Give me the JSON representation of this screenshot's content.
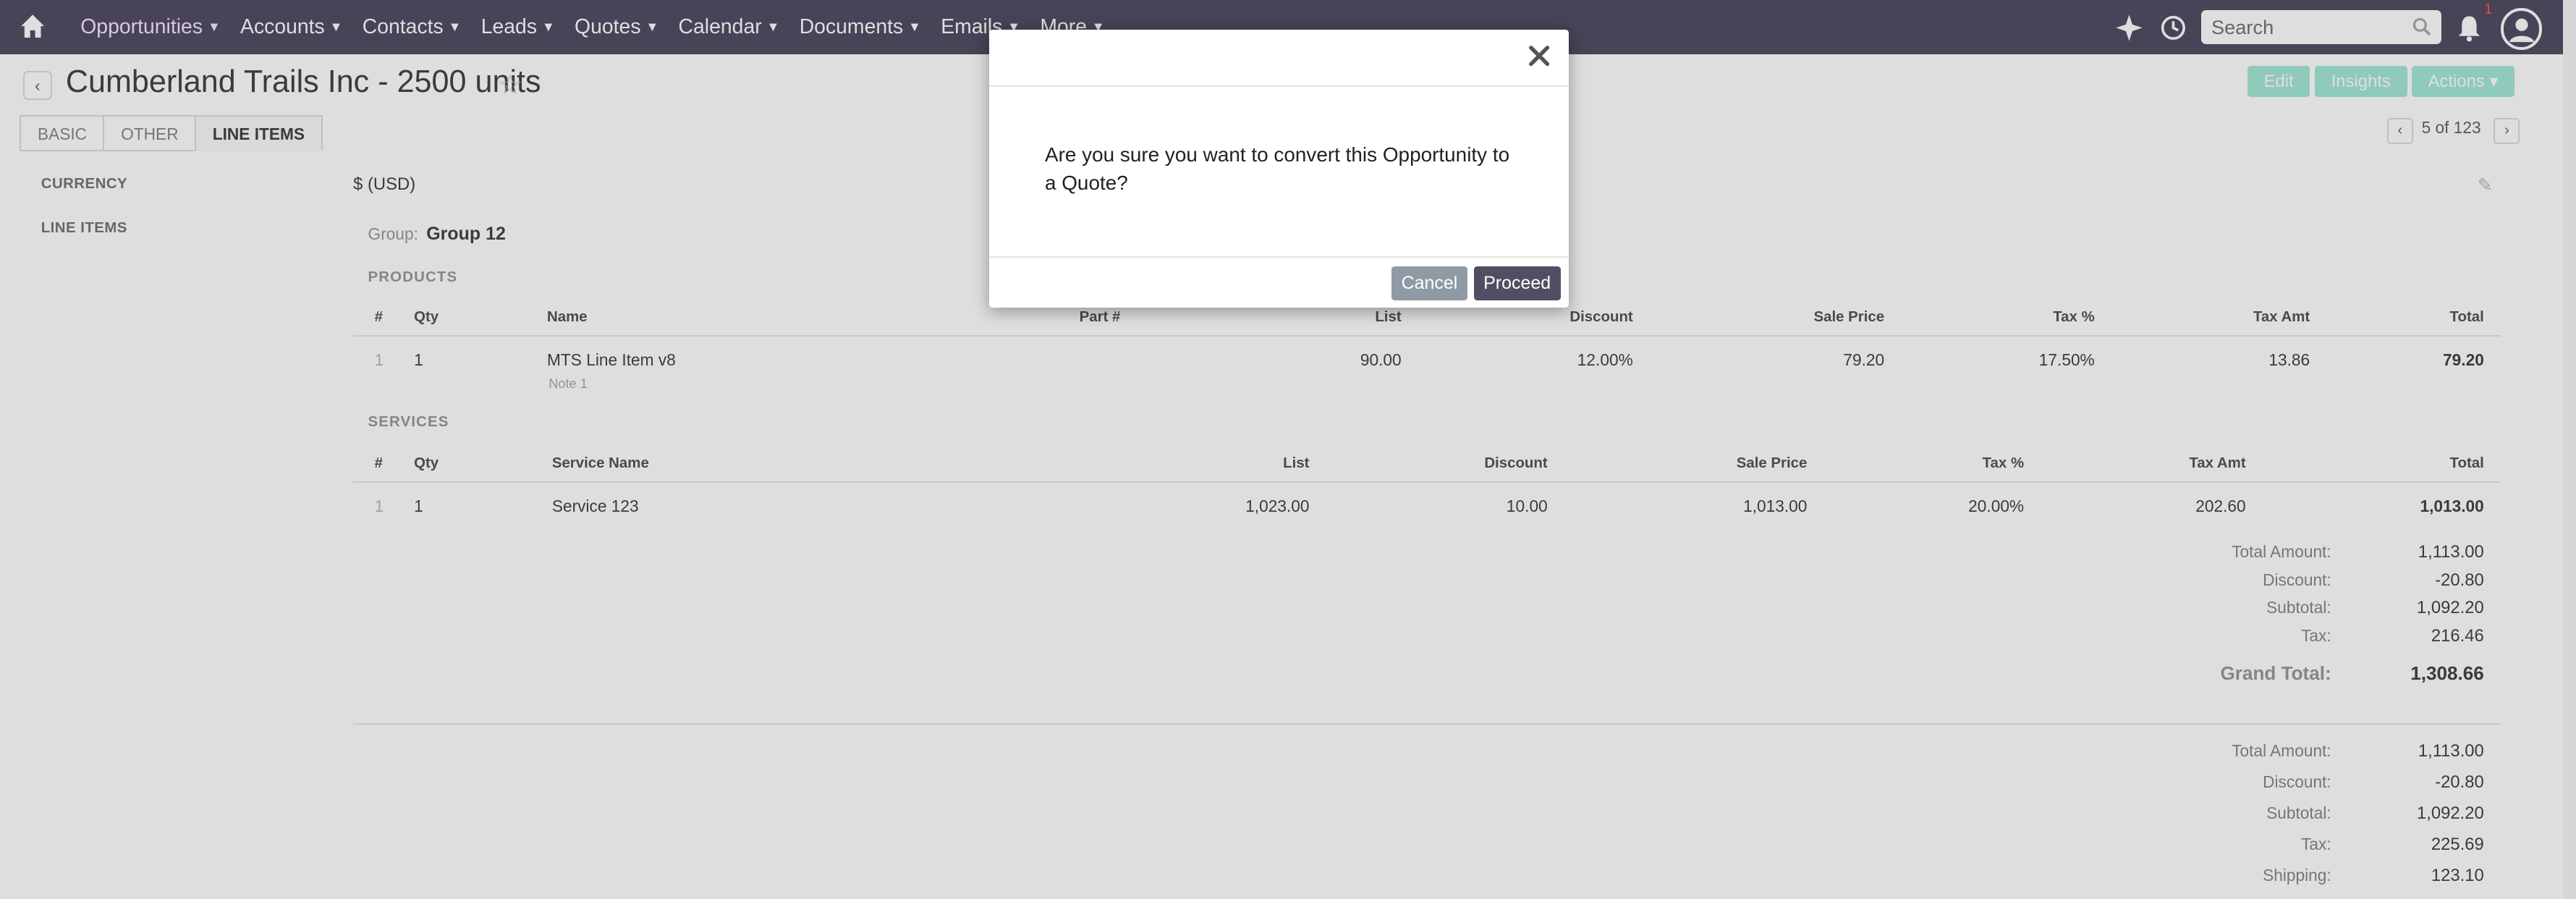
{
  "nav": {
    "modules": [
      {
        "label": "Opportunities",
        "active": true
      },
      {
        "label": "Accounts"
      },
      {
        "label": "Contacts"
      },
      {
        "label": "Leads"
      },
      {
        "label": "Quotes"
      },
      {
        "label": "Calendar"
      },
      {
        "label": "Documents"
      },
      {
        "label": "Emails"
      },
      {
        "label": "More"
      }
    ],
    "search_placeholder": "Search",
    "notification_count": "1",
    "icons": [
      "home-icon",
      "plus-icon",
      "recent-icon",
      "search-icon",
      "bell-icon",
      "user-avatar-icon"
    ]
  },
  "record": {
    "title": "Cumberland Trails Inc - 2500 units",
    "buttons": {
      "edit": "Edit",
      "insights": "Insights",
      "actions": "Actions"
    },
    "pager": "5 of 123",
    "tabs": [
      "BASIC",
      "OTHER",
      "LINE ITEMS"
    ],
    "fields": {
      "currency_label": "CURRENCY",
      "currency_value": "$ (USD)",
      "line_items_label": "LINE ITEMS"
    }
  },
  "line_items": {
    "group_label": "Group:",
    "group_name": "Group 12",
    "products_title": "PRODUCTS",
    "product_headers": [
      "#",
      "Qty",
      "Name",
      "Part #",
      "List",
      "Discount",
      "Sale Price",
      "Tax %",
      "Tax Amt",
      "Total"
    ],
    "product_rows": [
      {
        "num": "1",
        "qty": "1",
        "name": "MTS Line Item v8",
        "note": "Note 1",
        "part": "",
        "list": "90.00",
        "discount": "12.00%",
        "sale": "79.20",
        "tax_pct": "17.50%",
        "tax_amt": "13.86",
        "total": "79.20"
      }
    ],
    "services_title": "SERVICES",
    "service_headers": [
      "#",
      "Qty",
      "Service Name",
      "List",
      "Discount",
      "Sale Price",
      "Tax %",
      "Tax Amt",
      "Total"
    ],
    "service_rows": [
      {
        "num": "1",
        "qty": "1",
        "name": "Service 123",
        "list": "1,023.00",
        "discount": "10.00",
        "sale": "1,013.00",
        "tax_pct": "20.00%",
        "tax_amt": "202.60",
        "total": "1,013.00"
      }
    ],
    "group_totals": [
      {
        "label": "Total Amount:",
        "value": "1,113.00"
      },
      {
        "label": "Discount:",
        "value": "-20.80"
      },
      {
        "label": "Subtotal:",
        "value": "1,092.20"
      },
      {
        "label": "Tax:",
        "value": "216.46"
      }
    ],
    "grand_total_label": "Grand Total:",
    "grand_total_value": "1,308.66",
    "totals": [
      {
        "label": "Total Amount:",
        "value": "1,113.00"
      },
      {
        "label": "Discount:",
        "value": "-20.80"
      },
      {
        "label": "Subtotal:",
        "value": "1,092.20"
      },
      {
        "label": "Tax:",
        "value": "225.69"
      },
      {
        "label": "Shipping:",
        "value": "123.10"
      }
    ]
  },
  "modal": {
    "message": "Are you sure you want to convert this Opportunity to a Quote?",
    "cancel_label": "Cancel",
    "proceed_label": "Proceed"
  },
  "colors": {
    "nav_bg": "#534d64",
    "accent": "#a5e8d6",
    "proceed": "#534d64",
    "cancel": "#8f9aa5"
  }
}
